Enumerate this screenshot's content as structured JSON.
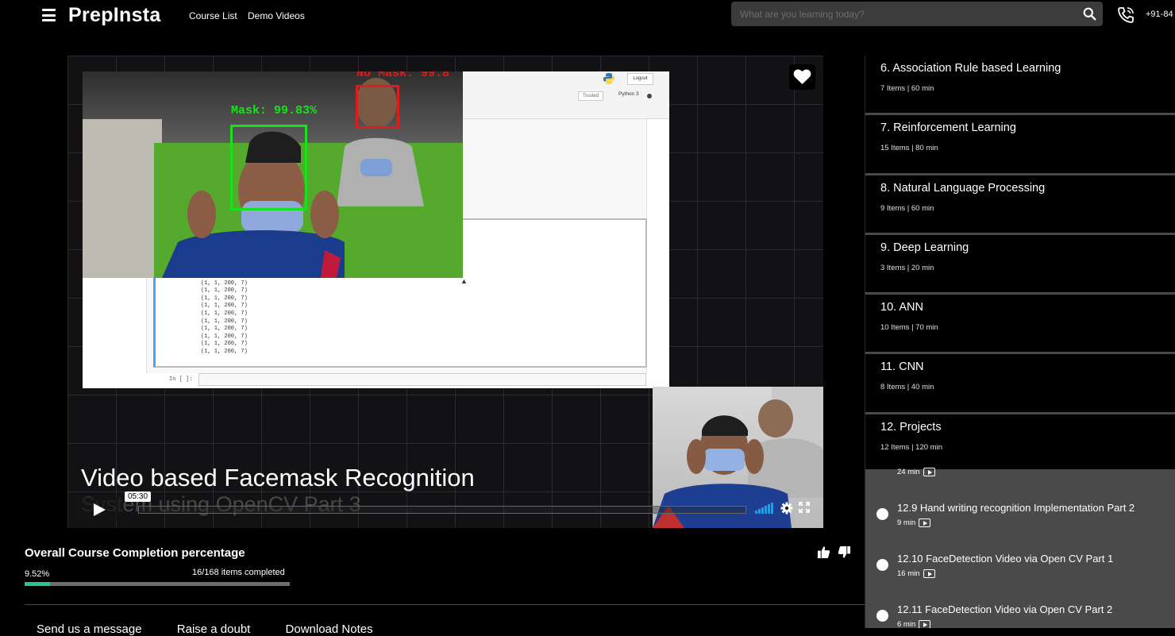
{
  "header": {
    "logo": "PrepInsta",
    "nav": [
      "Course List",
      "Demo Videos"
    ],
    "search_placeholder": "What are you learning today?",
    "phone": "+91-84"
  },
  "notebook": {
    "logout": "Logout",
    "trusted": "Trusted",
    "kernel": "Python 3",
    "output_line": "(1, 1, 200, 7)",
    "in_prompt": "In [ ]:"
  },
  "camera": {
    "mask_label": "Mask: 99.83%",
    "no_mask_label": "No Mask: 99.8"
  },
  "video": {
    "title": "Video based Facemask Recognition",
    "title_line2": "System using OpenCV Part 3",
    "time_tooltip": "05:30",
    "accent_color": "#00adef"
  },
  "completion": {
    "title": "Overall Course Completion percentage",
    "percent_text": "9.52%",
    "items_text": "16/168 items completed",
    "progress_fraction": 0.0952,
    "progress_color": "#2bc48a"
  },
  "bottom_tabs": [
    "Send us a message",
    "Raise a doubt",
    "Download Notes"
  ],
  "sidebar": {
    "modules": [
      {
        "title": "6. Association Rule based Learning",
        "meta": "7 Items | 60 min"
      },
      {
        "title": "7. Reinforcement Learning",
        "meta": "15 Items | 80 min"
      },
      {
        "title": "8. Natural Language Processing",
        "meta": "9 Items | 60 min"
      },
      {
        "title": "9. Deep Learning",
        "meta": "3 Items | 20 min"
      },
      {
        "title": "10. ANN",
        "meta": "10 Items | 70 min"
      },
      {
        "title": "11. CNN",
        "meta": "8 Items | 40 min"
      },
      {
        "title": "12. Projects",
        "meta": "12 Items | 120 min"
      }
    ],
    "sub_items": [
      {
        "title": "",
        "meta": "24 min"
      },
      {
        "title": "12.9 Hand writing recognition Implementation Part 2",
        "meta": "9 min"
      },
      {
        "title": "12.10 FaceDetection Video via Open CV Part 1",
        "meta": "16 min"
      },
      {
        "title": "12.11 FaceDetection Video via Open CV Part 2",
        "meta": "6 min"
      }
    ]
  }
}
